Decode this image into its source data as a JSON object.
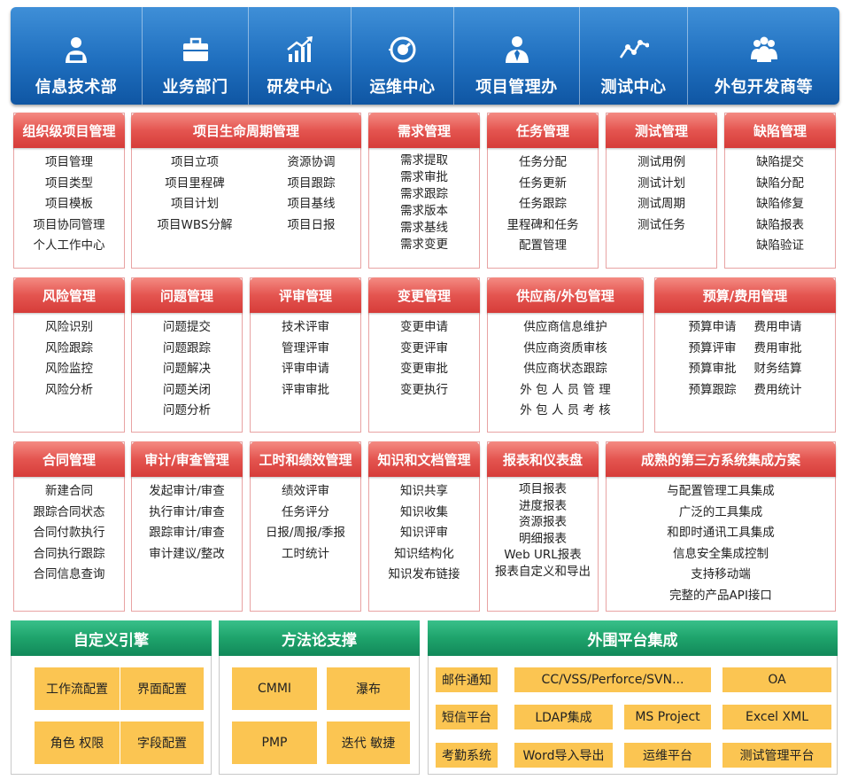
{
  "departments": [
    {
      "label": "信息技术部",
      "icon": "it-person-icon"
    },
    {
      "label": "业务部门",
      "icon": "briefcase-icon"
    },
    {
      "label": "研发中心",
      "icon": "growth-chart-icon"
    },
    {
      "label": "运维中心",
      "icon": "gauge-icon"
    },
    {
      "label": "项目管理办",
      "icon": "manager-icon"
    },
    {
      "label": "测试中心",
      "icon": "line-chart-icon"
    },
    {
      "label": "外包开发商等",
      "icon": "group-icon"
    }
  ],
  "modules": [
    {
      "title": "组织级项目管理",
      "items": [
        "项目管理",
        "项目类型",
        "项目模板",
        "项目协同管理",
        "个人工作中心"
      ]
    },
    {
      "title": "项目生命周期管理",
      "columns": [
        [
          "项目立项",
          "项目里程碑",
          "项目计划",
          "项目WBS分解"
        ],
        [
          "资源协调",
          "项目跟踪",
          "项目基线",
          "项目日报"
        ]
      ]
    },
    {
      "title": "需求管理",
      "items": [
        "需求提取",
        "需求审批",
        "需求跟踪",
        "需求版本",
        "需求基线",
        "需求变更"
      ]
    },
    {
      "title": "任务管理",
      "items": [
        "任务分配",
        "任务更新",
        "任务跟踪",
        "里程碑和任务",
        "配置管理"
      ]
    },
    {
      "title": "测试管理",
      "items": [
        "测试用例",
        "测试计划",
        "测试周期",
        "测试任务"
      ]
    },
    {
      "title": "缺陷管理",
      "items": [
        "缺陷提交",
        "缺陷分配",
        "缺陷修复",
        "缺陷报表",
        "缺陷验证"
      ]
    },
    {
      "title": "风险管理",
      "items": [
        "风险识别",
        "风险跟踪",
        "风险监控",
        "风险分析"
      ]
    },
    {
      "title": "问题管理",
      "items": [
        "问题提交",
        "问题跟踪",
        "问题解决",
        "问题关闭",
        "问题分析"
      ]
    },
    {
      "title": "评审管理",
      "items": [
        "技术评审",
        "管理评审",
        "评审申请",
        "评审审批"
      ]
    },
    {
      "title": "变更管理",
      "items": [
        "变更申请",
        "变更评审",
        "变更审批",
        "变更执行"
      ]
    },
    {
      "title": "供应商/外包管理",
      "items": [
        "供应商信息维护",
        "供应商资质审核",
        "供应商状态跟踪",
        "外 包 人 员 管 理",
        "外 包 人 员 考 核"
      ]
    },
    {
      "title": "预算/费用管理",
      "columns": [
        [
          "预算申请",
          "预算评审",
          "预算审批",
          "预算跟踪"
        ],
        [
          "费用申请",
          "费用审批",
          "财务结算",
          "费用统计"
        ]
      ]
    },
    {
      "title": "合同管理",
      "items": [
        "新建合同",
        "跟踪合同状态",
        "合同付款执行",
        "合同执行跟踪",
        "合同信息查询"
      ]
    },
    {
      "title": "审计/审查管理",
      "items": [
        "发起审计/审查",
        "执行审计/审查",
        "跟踪审计/审查",
        "审计建议/整改"
      ]
    },
    {
      "title": "工时和绩效管理",
      "items": [
        "绩效评审",
        "任务评分",
        "日报/周报/季报",
        "工时统计"
      ]
    },
    {
      "title": "知识和文档管理",
      "items": [
        "知识共享",
        "知识收集",
        "知识评审",
        "知识结构化",
        "知识发布链接"
      ]
    },
    {
      "title": "报表和仪表盘",
      "items": [
        "项目报表",
        "进度报表",
        "资源报表",
        "明细报表",
        "Web URL报表",
        "报表自定义和导出"
      ]
    },
    {
      "title": "成熟的第三方系统集成方案",
      "items": [
        "与配置管理工具集成",
        "广泛的工具集成",
        "和即时通讯工具集成",
        "信息安全集成控制",
        "支持移动端",
        "完整的产品API接口"
      ]
    }
  ],
  "groups": [
    {
      "title": "自定义引擎",
      "tiles": [
        "工作流配置",
        "界面配置",
        "角色   权限",
        "字段配置"
      ]
    },
    {
      "title": "方法论支撑",
      "tiles": [
        "CMMI",
        "瀑布",
        "PMP",
        "迭代  敏捷"
      ]
    },
    {
      "title": "外围平台集成",
      "tiles": [
        "邮件通知",
        "CC/VSS/Perforce/SVN...",
        "OA",
        "短信平台",
        "LDAP集成",
        "MS Project",
        "Excel   XML",
        "考勤系统",
        "Word导入导出",
        "运维平台",
        "测试管理平台"
      ]
    }
  ],
  "colors": {
    "header_blue": "#1f6fbf",
    "module_red": "#e45550",
    "group_green": "#1ea36b",
    "tile_orange": "#fbc552"
  }
}
